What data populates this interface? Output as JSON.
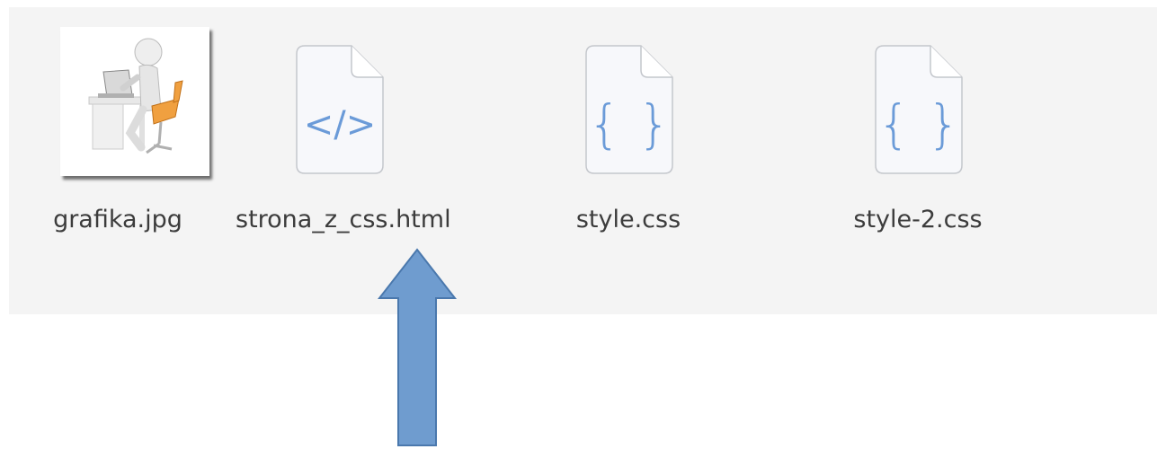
{
  "files": [
    {
      "name": "grafika.jpg",
      "icon": "image-thumbnail-icon"
    },
    {
      "name": "strona_z_css.html",
      "icon": "html-file-icon",
      "glyph": "</>"
    },
    {
      "name": "style.css",
      "icon": "css-file-icon",
      "glyph": "{ }"
    },
    {
      "name": "style-2.css",
      "icon": "css-file-icon",
      "glyph": "{ }"
    }
  ],
  "colors": {
    "background": "#f4f4f4",
    "icon_page": "#f7f8fb",
    "icon_outline": "#c4c7cc",
    "icon_glyph": "#6b9bd8",
    "arrow_fill": "#6f9ccf",
    "arrow_stroke": "#4a78ad"
  }
}
